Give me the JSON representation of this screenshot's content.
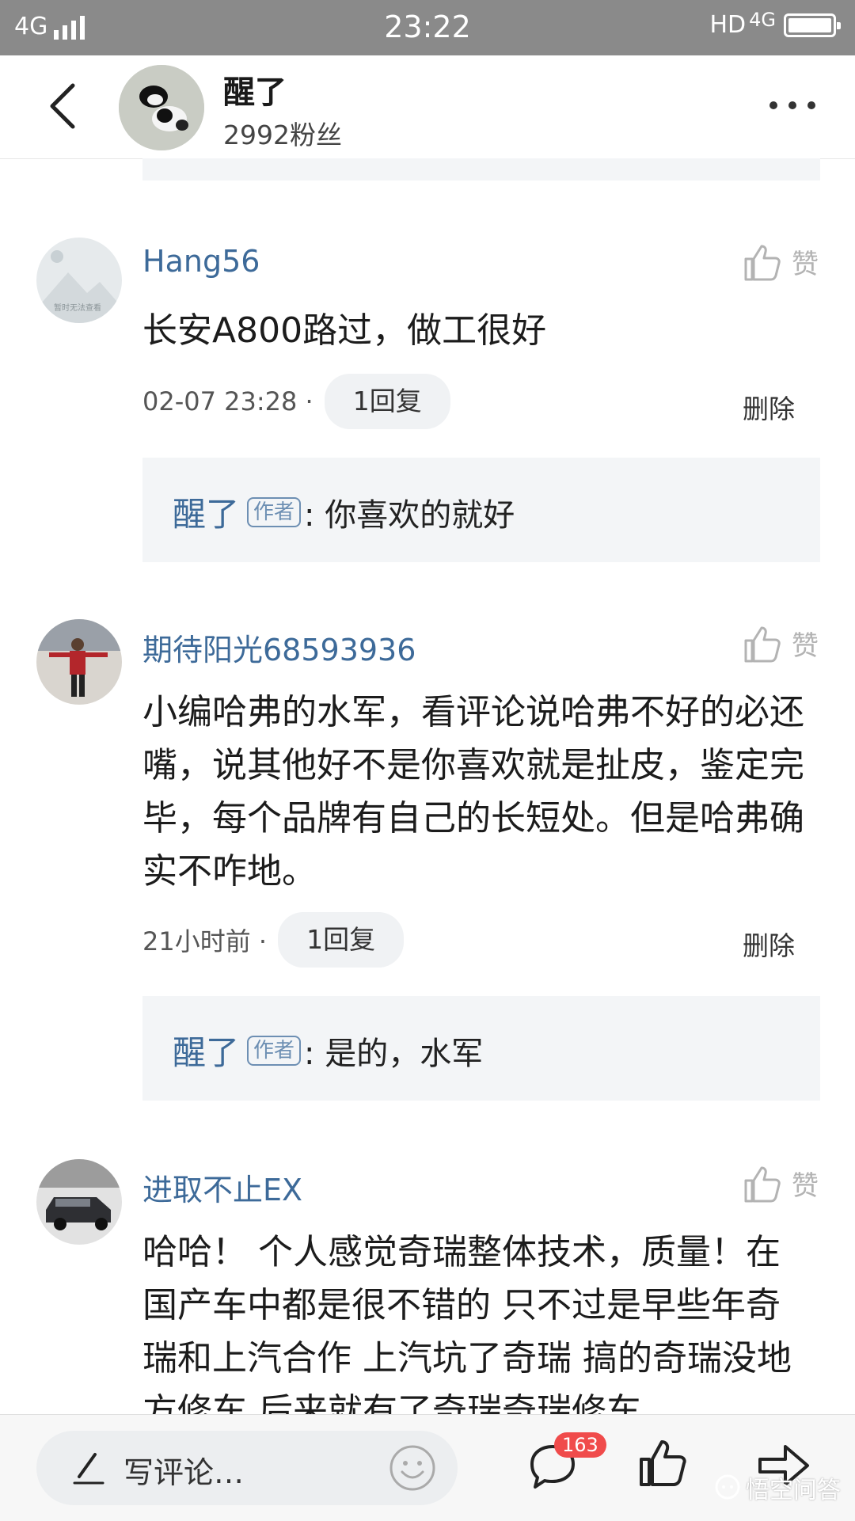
{
  "status_bar": {
    "network": "4G",
    "time": "23:22",
    "right_label": "HD",
    "right_network": "4G"
  },
  "header": {
    "title": "醒了",
    "fans": "2992粉丝"
  },
  "comments": [
    {
      "name": "Hang56",
      "like_label": "赞",
      "text": "长安A800路过，做工很好",
      "time": "02-07 23:28 ·",
      "reply_count": "1回复",
      "delete_label": "删除",
      "reply": {
        "author": "醒了",
        "badge": "作者",
        "text": ": 你喜欢的就好"
      },
      "avatar_caption": "暂时无法查看"
    },
    {
      "name": "期待阳光68593936",
      "like_label": "赞",
      "text": "小编哈弗的水军，看评论说哈弗不好的必还嘴，说其他好不是你喜欢就是扯皮，鉴定完毕，每个品牌有自己的长短处。但是哈弗确实不咋地。",
      "time": "21小时前 ·",
      "reply_count": "1回复",
      "delete_label": "删除",
      "reply": {
        "author": "醒了",
        "badge": "作者",
        "text": ": 是的，水军"
      }
    },
    {
      "name": "进取不止EX",
      "like_label": "赞",
      "text": "哈哈！ 个人感觉奇瑞整体技术，质量！在国产车中都是很不错的 只不过是早些年奇瑞和上汽合作 上汽坑了奇瑞 搞的奇瑞没地方修车 后来就有了奇瑞奇瑞修车"
    }
  ],
  "bottom_bar": {
    "write_placeholder": "写评论…",
    "comment_count": "163",
    "watermark": "悟空问答"
  }
}
